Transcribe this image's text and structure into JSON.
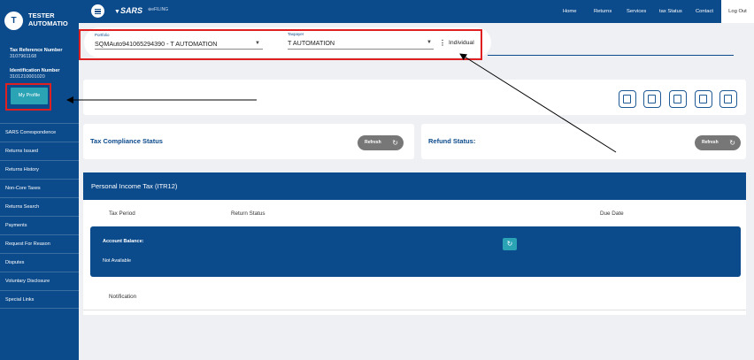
{
  "user": {
    "initials": "T",
    "name_line1": "TESTER",
    "name_line2": "AUTOMATIO"
  },
  "profile": {
    "tax_ref_label": "Tax Reference Number",
    "tax_ref_value": "3107961168",
    "id_label": "Identification Number",
    "id_value": "3101210001020",
    "my_profile_label": "My Profile"
  },
  "sidebar": {
    "items": [
      {
        "label": "SARS Correspondence"
      },
      {
        "label": "Returns Issued"
      },
      {
        "label": "Returns History"
      },
      {
        "label": "Non-Core Taxes"
      },
      {
        "label": "Returns Search"
      },
      {
        "label": "Payments"
      },
      {
        "label": "Request For Reason"
      },
      {
        "label": "Disputes"
      },
      {
        "label": "Voluntary Disclosure"
      },
      {
        "label": "Special Links"
      }
    ]
  },
  "topbar": {
    "logo": "SARS",
    "logo_sub": "eFILING",
    "nav": [
      "Home",
      "Returns",
      "Services",
      "tax Status",
      "Contact"
    ],
    "logout": "Log Out"
  },
  "selectors": {
    "portfolio_label": "Portfolio",
    "portfolio_value": "SQMAuto941065294390 - T AUTOMATION",
    "taxpayer_label": "Taxpayer",
    "taxpayer_value": "T AUTOMATION",
    "entity_type": "Individual"
  },
  "status": {
    "compliance_title": "Tax Compliance Status",
    "refund_title": "Refund Status:",
    "refresh_label": "Refresh"
  },
  "pit": {
    "title": "Personal Income Tax (ITR12)",
    "columns": [
      "Tax Period",
      "Return Status",
      "Due Date"
    ],
    "account_balance_label": "Account Balance:",
    "account_balance_value": "Not Available",
    "notification_label": "Notification"
  },
  "icons": {
    "refresh": "refresh-icon",
    "menu": "menu-icon",
    "actions": [
      "document-icon",
      "id-card-icon",
      "file-icon",
      "print-icon",
      "calculator-icon"
    ]
  },
  "colors": {
    "brand": "#0b4a8b",
    "accent": "#2aa3b5",
    "highlight": "#e02020"
  }
}
